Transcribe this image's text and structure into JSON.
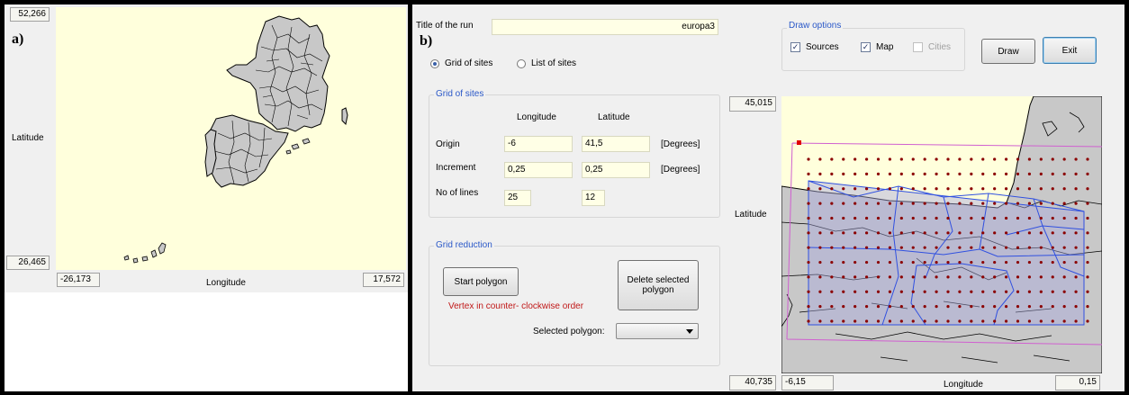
{
  "panel_a": {
    "letter": "a)",
    "lat_max": "52,266",
    "lat_min": "26,465",
    "lon_min": "-26,173",
    "lon_max": "17,572",
    "lat_label": "Latitude",
    "lon_label": "Longitude"
  },
  "panel_b": {
    "letter": "b)",
    "title_label": "Title of the run",
    "title_value": "europa3",
    "radio_grid": "Grid of sites",
    "radio_list": "List of sites",
    "grid_group": {
      "title": "Grid of sites",
      "col_longitude": "Longitude",
      "col_latitude": "Latitude",
      "row_origin": "Origin",
      "row_increment": "Increment",
      "row_lines": "No of lines",
      "origin_lon": "-6",
      "origin_lat": "41,5",
      "incr_lon": "0,25",
      "incr_lat": "0,25",
      "lines_lon": "25",
      "lines_lat": "12",
      "unit": "[Degrees]"
    },
    "reduction_group": {
      "title": "Grid reduction",
      "start_button": "Start polygon",
      "delete_button": "Delete selected polygon",
      "vertex_note": "Vertex in counter- clockwise order",
      "selected_label": "Selected polygon:",
      "selected_value": ""
    },
    "draw_options": {
      "title": "Draw options",
      "sources": "Sources",
      "map": "Map",
      "cities": "Cities"
    },
    "draw_button": "Draw",
    "exit_button": "Exit",
    "map": {
      "lat_max": "45,015",
      "lat_min": "40,735",
      "lon_min": "-6,15",
      "lon_max": "0,15",
      "lat_label": "Latitude",
      "lon_label": "Longitude"
    }
  },
  "colors": {
    "map_background": "#ffffdc",
    "land": "#c8c8c8",
    "grid_dot": "#8b0000",
    "polygon": "#3050e0",
    "group_title": "#2a58c8",
    "note_red": "#c01818"
  }
}
